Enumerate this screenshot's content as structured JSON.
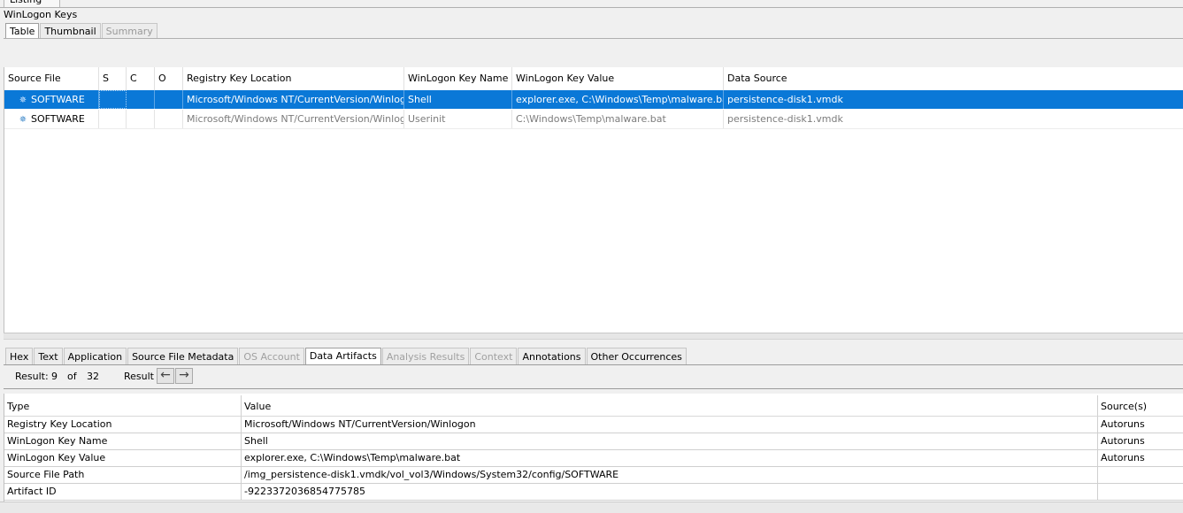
{
  "top_tab": {
    "label": "Listing"
  },
  "panel_title": "WinLogon Keys",
  "viewer_tabs": [
    {
      "label": "Table",
      "active": true,
      "enabled": true
    },
    {
      "label": "Thumbnail",
      "active": false,
      "enabled": true
    },
    {
      "label": "Summary",
      "active": false,
      "enabled": false
    }
  ],
  "results_table": {
    "columns": [
      "Source File",
      "S",
      "C",
      "O",
      "Registry Key Location",
      "WinLogon Key Name",
      "WinLogon Key Value",
      "Data Source"
    ],
    "rows": [
      {
        "selected": true,
        "source_file": "SOFTWARE",
        "s": "",
        "c": "",
        "o": "",
        "registry_key_location": "Microsoft/Windows NT/CurrentVersion/Winlogon",
        "key_name": "Shell",
        "key_value": "explorer.exe, C:\\Windows\\Temp\\malware.bat",
        "data_source": "persistence-disk1.vmdk"
      },
      {
        "selected": false,
        "source_file": "SOFTWARE",
        "s": "",
        "c": "",
        "o": "",
        "registry_key_location": "Microsoft/Windows NT/CurrentVersion/Winlogon",
        "key_name": "Userinit",
        "key_value": "C:\\Windows\\Temp\\malware.bat",
        "data_source": "persistence-disk1.vmdk"
      }
    ]
  },
  "content_tabs": [
    {
      "label": "Hex",
      "enabled": true,
      "active": false
    },
    {
      "label": "Text",
      "enabled": true,
      "active": false
    },
    {
      "label": "Application",
      "enabled": true,
      "active": false
    },
    {
      "label": "Source File Metadata",
      "enabled": true,
      "active": false
    },
    {
      "label": "OS Account",
      "enabled": false,
      "active": false
    },
    {
      "label": "Data Artifacts",
      "enabled": true,
      "active": true
    },
    {
      "label": "Analysis Results",
      "enabled": false,
      "active": false
    },
    {
      "label": "Context",
      "enabled": false,
      "active": false
    },
    {
      "label": "Annotations",
      "enabled": true,
      "active": false
    },
    {
      "label": "Other Occurrences",
      "enabled": true,
      "active": false
    }
  ],
  "result_nav": {
    "label": "Result:",
    "current": "9",
    "of": "of",
    "total": "32",
    "word": "Result",
    "prev_icon": "arrow-left-icon",
    "next_icon": "arrow-right-icon"
  },
  "artifact_table": {
    "columns": [
      "Type",
      "Value",
      "Source(s)"
    ],
    "rows": [
      {
        "type": "Registry Key Location",
        "value": "Microsoft/Windows NT/CurrentVersion/Winlogon",
        "sources": "Autoruns"
      },
      {
        "type": "WinLogon Key Name",
        "value": "Shell",
        "sources": "Autoruns"
      },
      {
        "type": "WinLogon Key Value",
        "value": "explorer.exe, C:\\Windows\\Temp\\malware.bat",
        "sources": "Autoruns"
      },
      {
        "type": "Source File Path",
        "value": "/img_persistence-disk1.vmdk/vol_vol3/Windows/System32/config/SOFTWARE",
        "sources": ""
      },
      {
        "type": "Artifact ID",
        "value": "-9223372036854775785",
        "sources": ""
      }
    ]
  },
  "colors": {
    "selection": "#0a78d7",
    "disabled_text": "#9a9a9a"
  }
}
